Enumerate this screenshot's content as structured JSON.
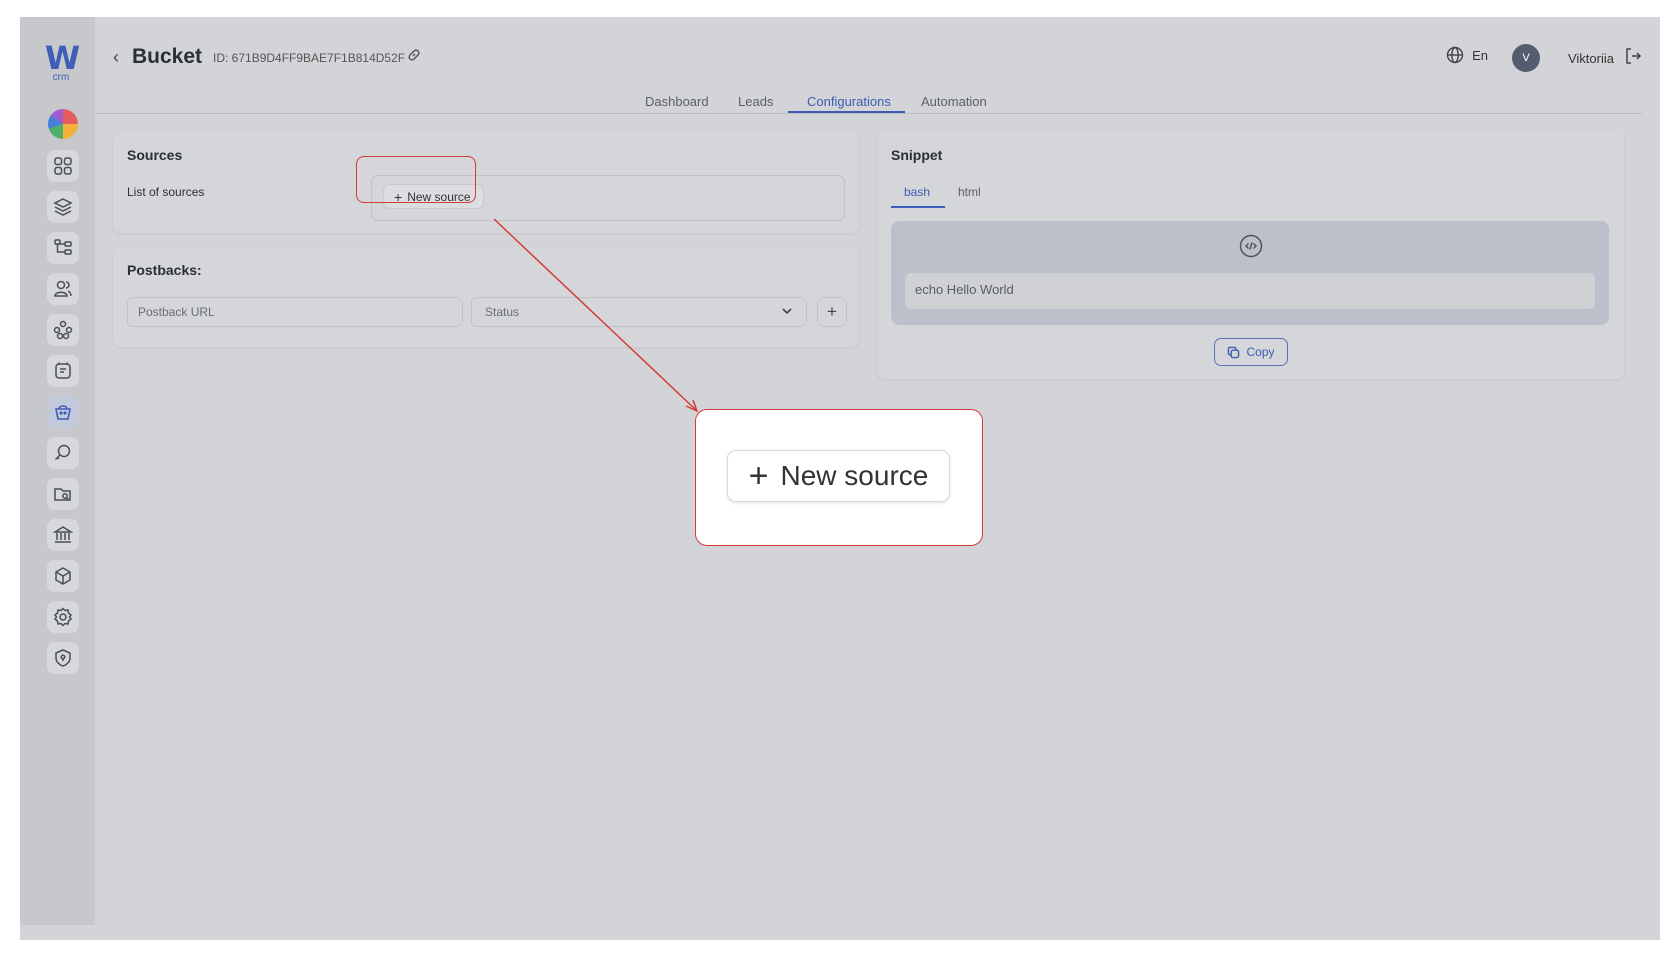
{
  "app": {
    "logo_letter": "W",
    "logo_sub": "crm"
  },
  "sidebar": {
    "items": [
      {
        "icon": "dashboard-grid-icon"
      },
      {
        "icon": "layers-icon"
      },
      {
        "icon": "hierarchy-icon"
      },
      {
        "icon": "users-icon"
      },
      {
        "icon": "network-icon"
      },
      {
        "icon": "notes-icon"
      },
      {
        "icon": "bucket-icon",
        "active": true
      },
      {
        "icon": "key-search-icon"
      },
      {
        "icon": "folder-search-icon"
      },
      {
        "icon": "bank-icon"
      },
      {
        "icon": "cube-icon"
      },
      {
        "icon": "settings-icon"
      },
      {
        "icon": "shield-icon"
      }
    ]
  },
  "header": {
    "title": "Bucket",
    "id_label": "ID: 671B9D4FF9BAE7F1B814D52F",
    "language": "En",
    "avatar_initial": "V",
    "user_name": "Viktoriia"
  },
  "tabs": [
    {
      "label": "Dashboard",
      "active": false
    },
    {
      "label": "Leads",
      "active": false
    },
    {
      "label": "Configurations",
      "active": true
    },
    {
      "label": "Automation",
      "active": false
    }
  ],
  "sources": {
    "title": "Sources",
    "list_label": "List of sources",
    "new_source_label": "New source"
  },
  "postbacks": {
    "title": "Postbacks:",
    "url_placeholder": "Postback URL",
    "status_placeholder": "Status",
    "add_label": "+"
  },
  "snippet": {
    "title": "Snippet",
    "tabs": [
      {
        "label": "bash",
        "active": true
      },
      {
        "label": "html",
        "active": false
      }
    ],
    "code": "echo Hello World",
    "copy_label": "Copy"
  },
  "callout": {
    "label": "New source"
  },
  "colors": {
    "accent": "#3d5cb5",
    "highlight": "#d43b3b"
  }
}
